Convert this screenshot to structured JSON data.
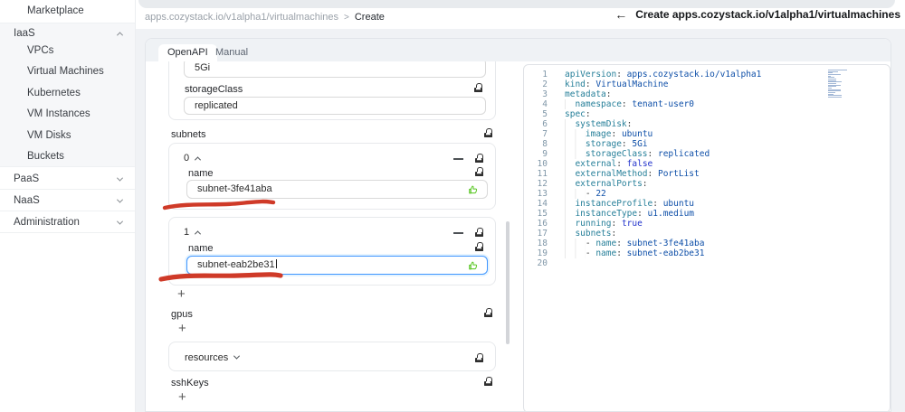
{
  "colors": {
    "accent_blue": "#4096ff",
    "like_green": "#52c41a",
    "annotation_red": "#cf3a28",
    "code_key": "#267f99",
    "code_value": "#0e4fa8",
    "code_keyword": "#2233cc"
  },
  "sidebar": {
    "marketplace": "Marketplace",
    "groups": [
      {
        "label": "IaaS",
        "state": "expanded",
        "children": [
          "VPCs",
          "Virtual Machines",
          "Kubernetes",
          "VM Instances",
          "VM Disks",
          "Buckets"
        ]
      },
      {
        "label": "PaaS",
        "state": "collapsed"
      },
      {
        "label": "NaaS",
        "state": "collapsed"
      },
      {
        "label": "Administration",
        "state": "collapsed"
      }
    ]
  },
  "breadcrumb": {
    "path": "apps.cozystack.io/v1alpha1/virtualmachines",
    "separator": ">",
    "current": "Create"
  },
  "header": {
    "title": "Create apps.cozystack.io/v1alpha1/virtualmachines"
  },
  "tabs": {
    "openapi": "OpenAPI",
    "manual": "Manual",
    "active": "OpenAPI"
  },
  "form": {
    "partial_top_field": {
      "value": "5Gi"
    },
    "storage_class": {
      "label": "storageClass",
      "value": "replicated"
    },
    "subnets": {
      "label": "subnets",
      "items": [
        {
          "index": "0",
          "field_label": "name",
          "value": "subnet-3fe41aba",
          "focused": false
        },
        {
          "index": "1",
          "field_label": "name",
          "value": "subnet-eab2be31",
          "focused": true
        }
      ],
      "add_button": "+"
    },
    "gpus": {
      "label": "gpus",
      "add_button": "+"
    },
    "resources": {
      "label": "resources"
    },
    "ssh_keys": {
      "label": "sshKeys",
      "add_button": "+"
    }
  },
  "editor": {
    "lines": [
      {
        "ind": 0,
        "tok": [
          [
            "k",
            "apiVersion"
          ],
          [
            "p",
            ": "
          ],
          [
            "v",
            "apps.cozystack.io/v1alpha1"
          ]
        ]
      },
      {
        "ind": 0,
        "tok": [
          [
            "k",
            "kind"
          ],
          [
            "p",
            ": "
          ],
          [
            "v",
            "VirtualMachine"
          ]
        ]
      },
      {
        "ind": 0,
        "tok": [
          [
            "k",
            "metadata"
          ],
          [
            "p",
            ":"
          ]
        ]
      },
      {
        "ind": 2,
        "tok": [
          [
            "k",
            "namespace"
          ],
          [
            "p",
            ": "
          ],
          [
            "v",
            "tenant-user0"
          ]
        ]
      },
      {
        "ind": 0,
        "tok": [
          [
            "k",
            "spec"
          ],
          [
            "p",
            ":"
          ]
        ]
      },
      {
        "ind": 2,
        "tok": [
          [
            "k",
            "systemDisk"
          ],
          [
            "p",
            ":"
          ]
        ]
      },
      {
        "ind": 4,
        "tok": [
          [
            "k",
            "image"
          ],
          [
            "p",
            ": "
          ],
          [
            "v",
            "ubuntu"
          ]
        ]
      },
      {
        "ind": 4,
        "tok": [
          [
            "k",
            "storage"
          ],
          [
            "p",
            ": "
          ],
          [
            "v",
            "5Gi"
          ]
        ]
      },
      {
        "ind": 4,
        "tok": [
          [
            "k",
            "storageClass"
          ],
          [
            "p",
            ": "
          ],
          [
            "v",
            "replicated"
          ]
        ]
      },
      {
        "ind": 2,
        "tok": [
          [
            "k",
            "external"
          ],
          [
            "p",
            ": "
          ],
          [
            "kw",
            "false"
          ]
        ]
      },
      {
        "ind": 2,
        "tok": [
          [
            "k",
            "externalMethod"
          ],
          [
            "p",
            ": "
          ],
          [
            "v",
            "PortList"
          ]
        ]
      },
      {
        "ind": 2,
        "tok": [
          [
            "k",
            "externalPorts"
          ],
          [
            "p",
            ":"
          ]
        ]
      },
      {
        "ind": 4,
        "tok": [
          [
            "p",
            "- "
          ],
          [
            "n",
            "22"
          ]
        ]
      },
      {
        "ind": 2,
        "tok": [
          [
            "k",
            "instanceProfile"
          ],
          [
            "p",
            ": "
          ],
          [
            "v",
            "ubuntu"
          ]
        ]
      },
      {
        "ind": 2,
        "tok": [
          [
            "k",
            "instanceType"
          ],
          [
            "p",
            ": "
          ],
          [
            "v",
            "u1.medium"
          ]
        ]
      },
      {
        "ind": 2,
        "tok": [
          [
            "k",
            "running"
          ],
          [
            "p",
            ": "
          ],
          [
            "kw",
            "true"
          ]
        ]
      },
      {
        "ind": 2,
        "tok": [
          [
            "k",
            "subnets"
          ],
          [
            "p",
            ":"
          ]
        ]
      },
      {
        "ind": 4,
        "tok": [
          [
            "p",
            "- "
          ],
          [
            "k",
            "name"
          ],
          [
            "p",
            ": "
          ],
          [
            "v",
            "subnet-3fe41aba"
          ]
        ]
      },
      {
        "ind": 4,
        "tok": [
          [
            "p",
            "- "
          ],
          [
            "k",
            "name"
          ],
          [
            "p",
            ": "
          ],
          [
            "v",
            "subnet-eab2be31"
          ]
        ]
      },
      {
        "ind": 0,
        "tok": []
      }
    ]
  }
}
